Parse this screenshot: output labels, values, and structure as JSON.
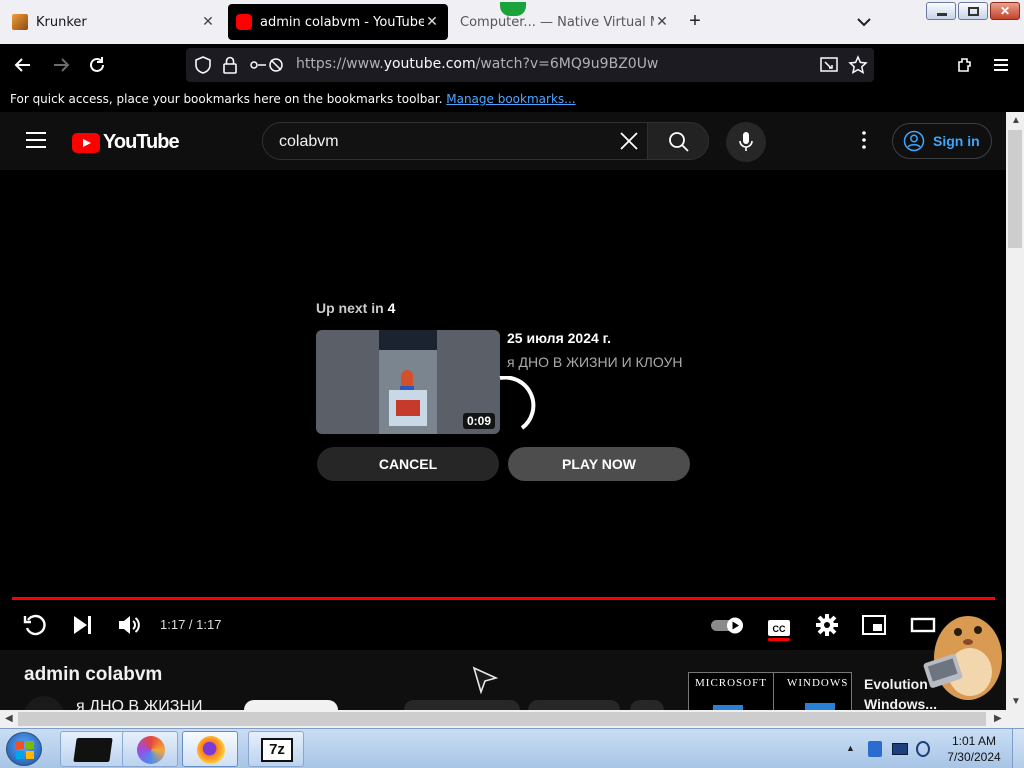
{
  "browser": {
    "tabs": [
      {
        "title": "Krunker",
        "active": false
      },
      {
        "title": "admin colabvm - YouTube",
        "active": true
      },
      {
        "title": "Computer... — Native Virtual Machi",
        "active": false
      }
    ],
    "new_tab_symbol": "+",
    "url": {
      "prefix": "https://www.",
      "host": "youtube.com",
      "path": "/watch?v=6MQ9u9BZ0Uw"
    },
    "bookmarks_bar": {
      "text": "For quick access, place your bookmarks here on the bookmarks toolbar.",
      "link": "Manage bookmarks..."
    }
  },
  "youtube": {
    "logo_text": "YouTube",
    "search": {
      "value": "colabvm"
    },
    "sign_in_label": "Sign in",
    "player": {
      "up_next_label": "Up next in",
      "up_next_seconds": "4",
      "next_video": {
        "title": "25 июля 2024 г.",
        "channel": "я ДНО В ЖИЗНИ И КЛОУН",
        "duration": "0:09"
      },
      "cancel_label": "CANCEL",
      "play_now_label": "PLAY NOW",
      "time_display": "1:17 / 1:17",
      "progress_fraction": 1.0
    },
    "below": {
      "video_title": "admin colabvm",
      "channel_partial": "я ДНО В ЖИЗНИ",
      "ad": {
        "brand1": "MICROSOFT",
        "brand2": "WINDOWS",
        "title": "Evolution Windows..."
      }
    }
  },
  "taskbar": {
    "clock_time": "1:01 AM",
    "clock_date": "7/30/2024"
  },
  "colors": {
    "youtube_red": "#ff0000",
    "link_blue": "#3ea6ff",
    "accent_blue": "#4ea5ff"
  }
}
